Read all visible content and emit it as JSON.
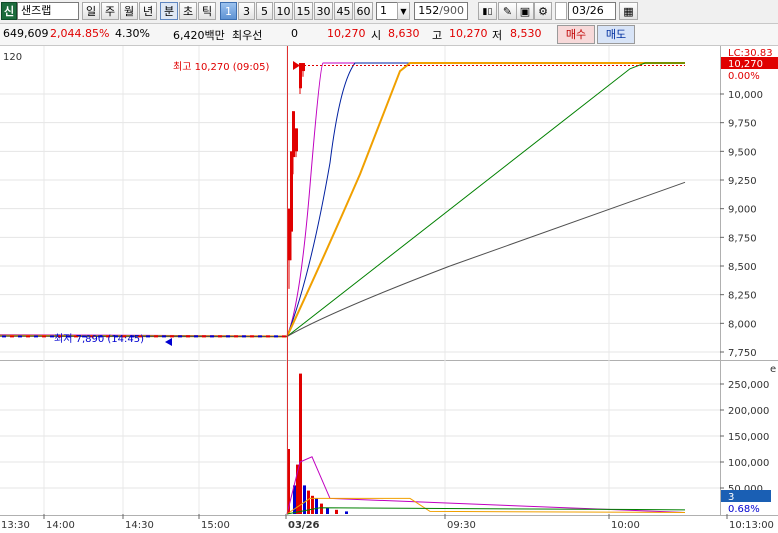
{
  "toolbar": {
    "code_badge": "신",
    "stock_name": "샌즈랩",
    "period_buttons": [
      "일",
      "주",
      "월",
      "년",
      "분",
      "초",
      "틱"
    ],
    "active_period": "분",
    "interval_buttons": [
      "1",
      "3",
      "5",
      "10",
      "15",
      "30",
      "45",
      "60"
    ],
    "active_interval": "1",
    "interval_select": "1",
    "count_value": "152",
    "count_total": "/900",
    "date_value": "03/26"
  },
  "info": {
    "volume": "649,609",
    "change_pct": "2,044.85%",
    "turnover": "4.30%",
    "amount": "6,420백만",
    "best_label": "최우선",
    "best_value": "0",
    "current": "10,270",
    "open_label": "시",
    "open": "8,630",
    "high_label": "고",
    "high": "10,270",
    "low_label": "저",
    "low": "8,530",
    "buy_label": "매수",
    "sell_label": "매도"
  },
  "price_panel": {
    "corner_label": "120",
    "lc_badge": "LC:30.83",
    "current_badge": "10,270",
    "pct_badge": "0.00%",
    "high_annotation": "최고 10,270 (09:05)",
    "low_annotation": "최저 7,890 (14:45)",
    "y_ticks": [
      "10,000",
      "9,750",
      "9,500",
      "9,250",
      "9,000",
      "8,750",
      "8,500",
      "8,250",
      "8,000",
      "7,750"
    ]
  },
  "volume_panel": {
    "corner_icon": "e",
    "y_ticks": [
      "250,000",
      "200,000",
      "150,000",
      "100,000",
      "50,000"
    ],
    "current_badge": "3",
    "pct_badge": "0.68%"
  },
  "time_axis": {
    "labels": [
      "13:30",
      "14:00",
      "14:30",
      "15:00",
      "03/26",
      "09:30",
      "10:00",
      "10:13:00"
    ]
  },
  "colors": {
    "up": "#e00000",
    "down": "#0000d0",
    "ma_magenta": "#c000c0",
    "ma_navy": "#0020a0",
    "ma_orange": "#f0a000",
    "ma_green": "#008000",
    "ma_gray": "#505050"
  }
}
